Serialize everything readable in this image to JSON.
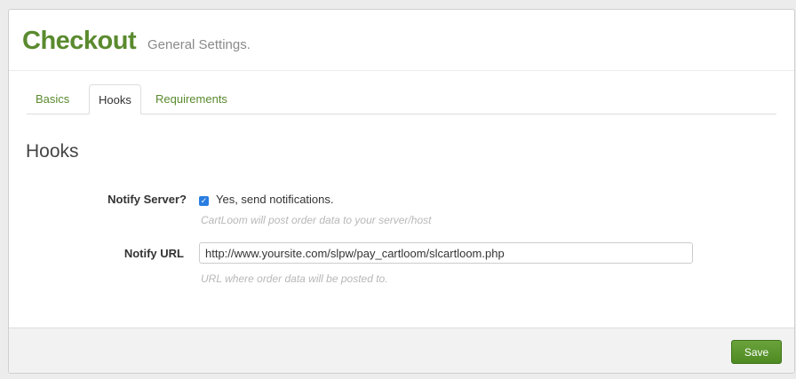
{
  "header": {
    "title": "Checkout",
    "subtitle": "General Settings."
  },
  "tabs": [
    {
      "label": "Basics",
      "active": false
    },
    {
      "label": "Hooks",
      "active": true
    },
    {
      "label": "Requirements",
      "active": false
    }
  ],
  "section": {
    "title": "Hooks"
  },
  "notify_server": {
    "label": "Notify Server?",
    "checked": true,
    "checkbox_label": "Yes, send notifications.",
    "help": "CartLoom will post order data to your server/host"
  },
  "notify_url": {
    "label": "Notify URL",
    "value": "http://www.yoursite.com/slpw/pay_cartloom/slcartloom.php",
    "help": "URL where order data will be posted to."
  },
  "footer": {
    "save_label": "Save"
  },
  "colors": {
    "brand": "#5a8a2e",
    "checkbox": "#2a7de1",
    "save_button": "#5a9a2e"
  }
}
